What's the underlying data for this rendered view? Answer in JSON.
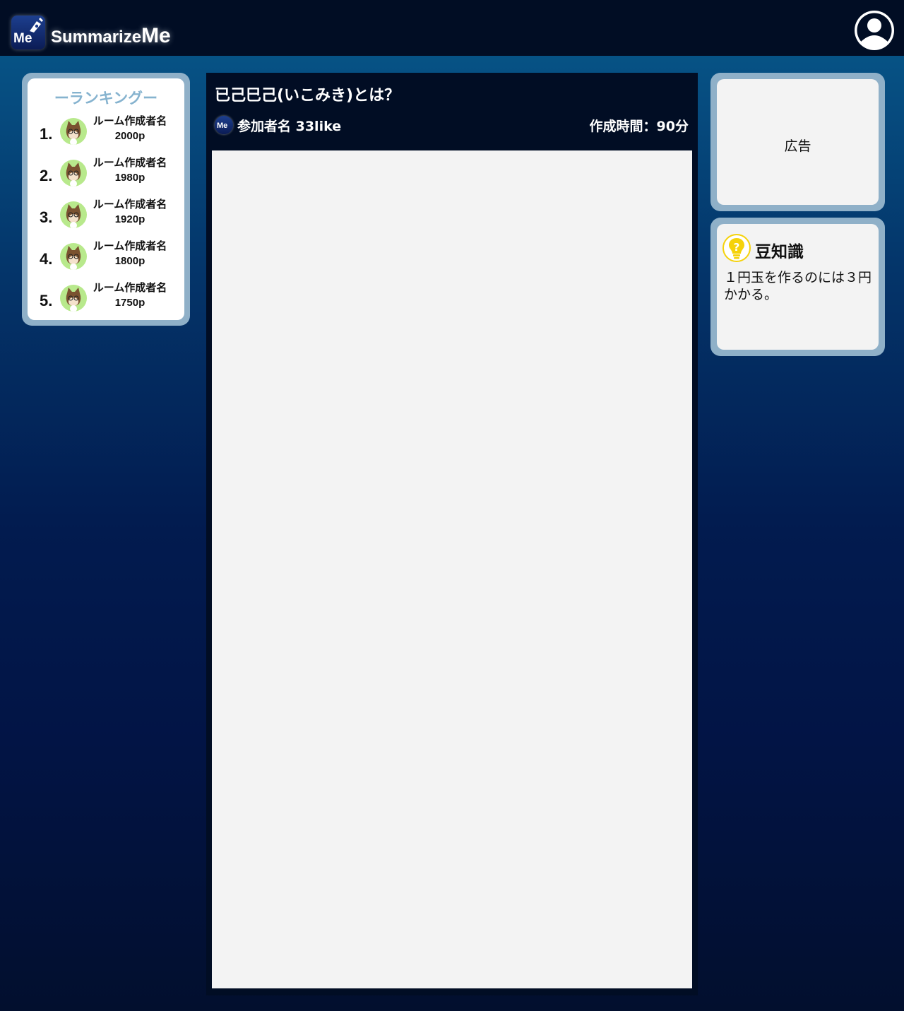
{
  "header": {
    "logo_mark_text": "Me",
    "logo_text_main": "Summarize",
    "logo_text_big": "Me"
  },
  "ranking": {
    "title": "ーランキングー",
    "items": [
      {
        "rank": "1.",
        "name": "ルーム作成者名",
        "points": "2000p"
      },
      {
        "rank": "2.",
        "name": "ルーム作成者名",
        "points": "1980p"
      },
      {
        "rank": "3.",
        "name": "ルーム作成者名",
        "points": "1920p"
      },
      {
        "rank": "4.",
        "name": "ルーム作成者名",
        "points": "1800p"
      },
      {
        "rank": "5.",
        "name": "ルーム作成者名",
        "points": "1750p"
      }
    ]
  },
  "main": {
    "title": "已己巳己(いこみき)とは？",
    "avatar_text": "Me",
    "participant": "参加者名 33like",
    "created_time": "作成時間：90分"
  },
  "ad": {
    "label": "広告"
  },
  "tip": {
    "title": "豆知識",
    "text": "１円玉を作るのには３円かかる。"
  },
  "colors": {
    "header_bg": "#010d24",
    "panel_border": "#8fb0c8",
    "ranking_title": "#86b3cf",
    "avatar_bg": "#b8e98c",
    "content_bg": "#f3f3f3",
    "tip_icon": "#f5d20a"
  }
}
